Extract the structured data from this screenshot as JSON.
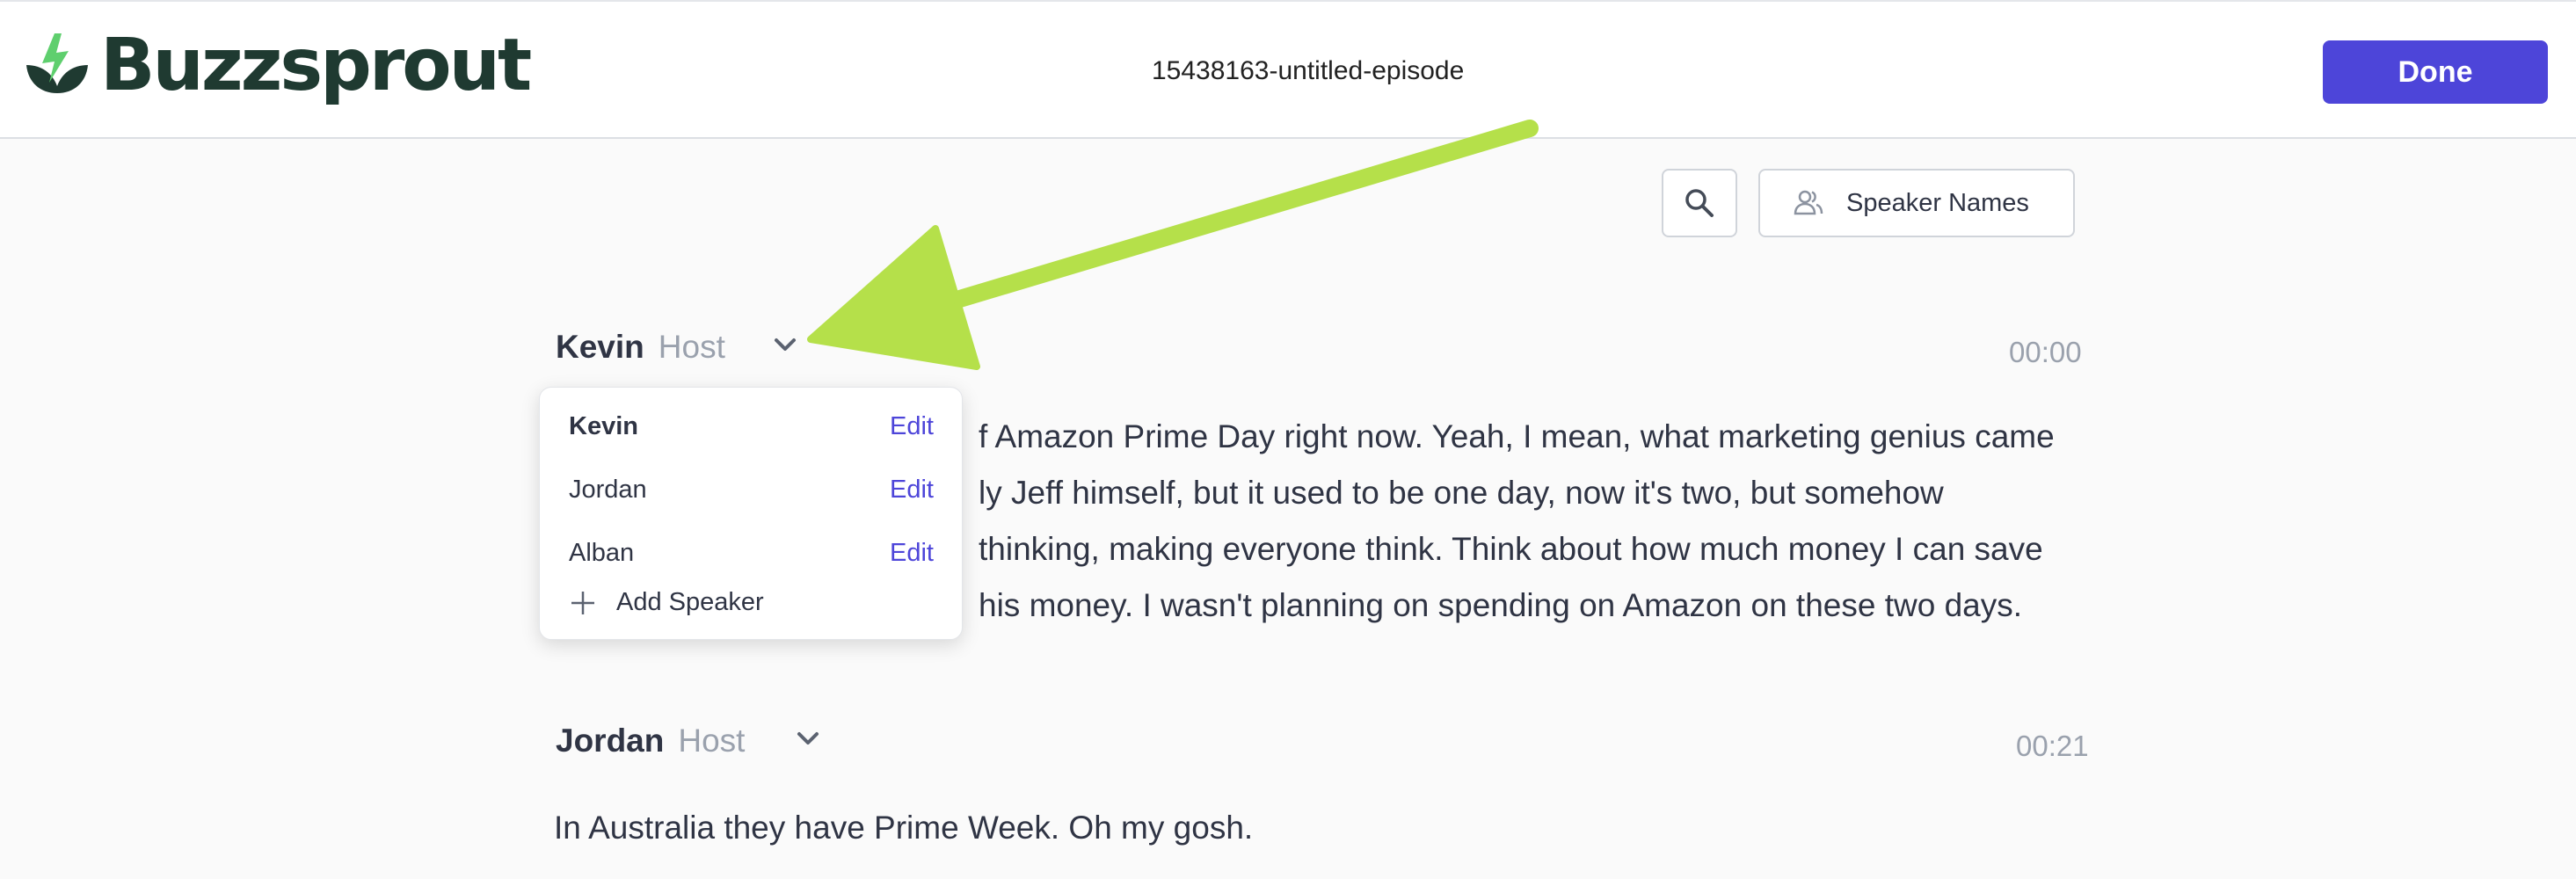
{
  "header": {
    "logo_text": "Buzzsprout",
    "episode_title": "15438163-untitled-episode",
    "done_label": "Done"
  },
  "toolbar": {
    "search_icon": "search-icon",
    "speaker_names_label": "Speaker Names"
  },
  "segments": [
    {
      "speaker": "Kevin",
      "role": "Host",
      "time": "00:00",
      "lines": [
        "f Amazon Prime Day right now. Yeah, I mean, what marketing genius came",
        "ly Jeff himself, but it used to be one day, now it's two, but somehow",
        " thinking, making everyone think. Think about how much money I can save",
        "his money. I wasn't planning on spending on Amazon on these two days."
      ]
    },
    {
      "speaker": "Jordan",
      "role": "Host",
      "time": "00:21",
      "lines": [
        "In Australia they have Prime Week. Oh my gosh."
      ]
    }
  ],
  "speaker_dropdown": {
    "items": [
      {
        "name": "Kevin",
        "edit": "Edit"
      },
      {
        "name": "Jordan",
        "edit": "Edit"
      },
      {
        "name": "Alban",
        "edit": "Edit"
      }
    ],
    "add_label": "Add Speaker"
  },
  "colors": {
    "accent": "#4d45d9",
    "annotation_arrow": "#b5e04a",
    "logo_green": "#1f3a31"
  }
}
